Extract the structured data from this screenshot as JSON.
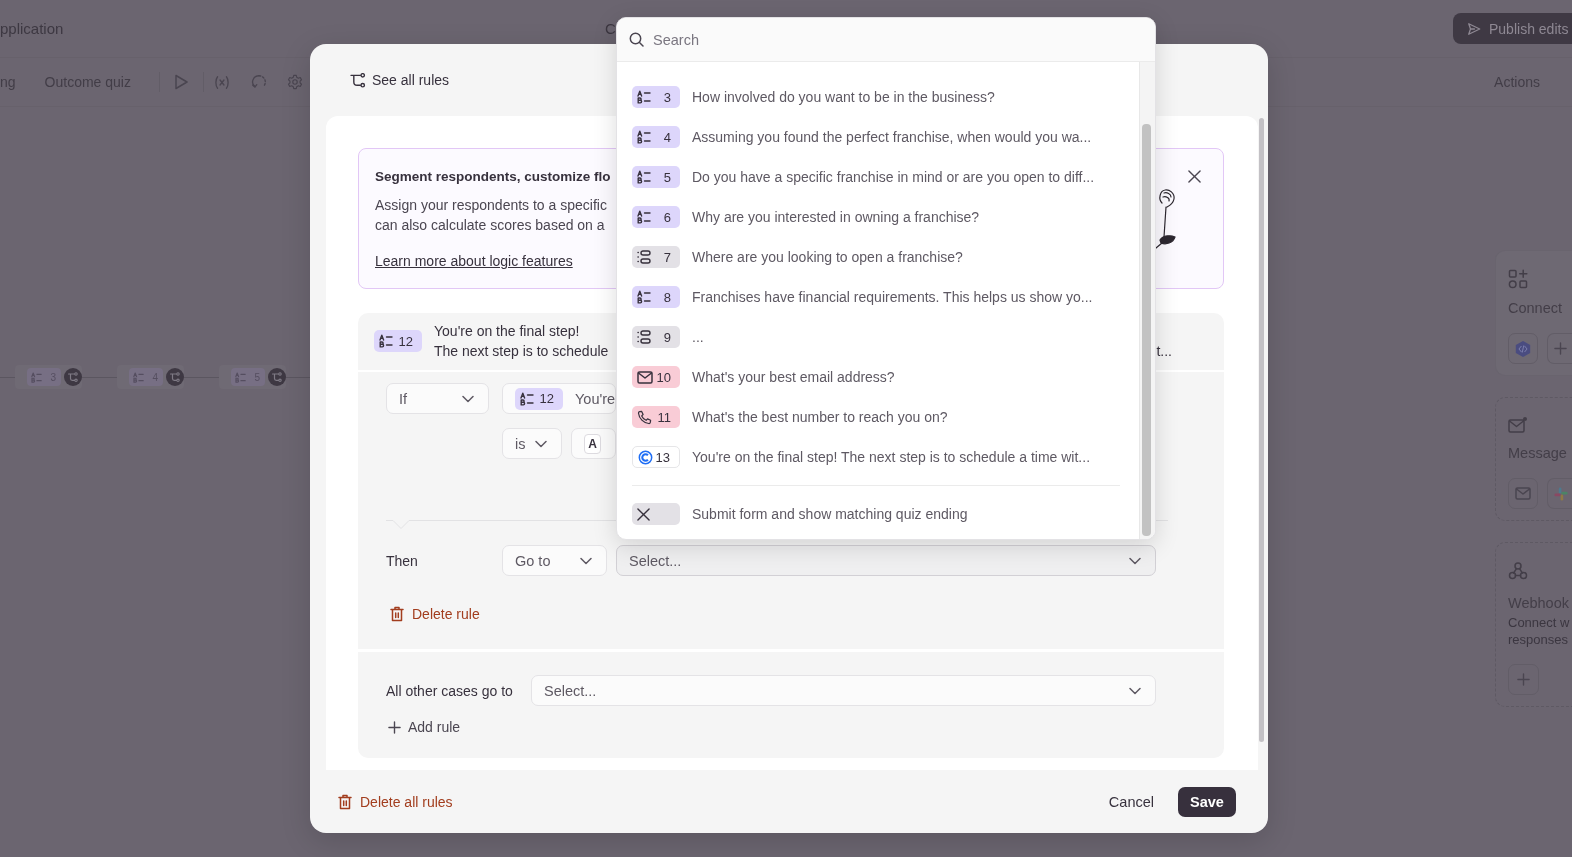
{
  "background": {
    "top_bar": {
      "title": "pplication",
      "center_text": "C",
      "publish_button": "Publish edits"
    },
    "toolbar": {
      "tabs": [
        "ng",
        "Outcome quiz"
      ],
      "actions_label": "Actions"
    },
    "canvas_nodes": [
      {
        "number": "3"
      },
      {
        "number": "4"
      },
      {
        "number": "5"
      }
    ],
    "integrations": [
      {
        "kind": "connect",
        "title": "Connect"
      },
      {
        "kind": "messages",
        "title": "Message"
      },
      {
        "kind": "webhook",
        "title": "Webhook",
        "description_lines": [
          "Connect w",
          "responses"
        ]
      }
    ]
  },
  "modal": {
    "header_link": "See all rules",
    "info_card": {
      "title": "Segment respondents, customize flo",
      "body_lines": [
        "Assign your respondents to a specific",
        "can also calculate scores based on a"
      ],
      "link": "Learn more about logic features"
    },
    "rule": {
      "question": {
        "kind": "multiple_choice",
        "number": "12",
        "lines": [
          "You're on the final step!",
          "The next step is to schedule"
        ],
        "tail": "t..."
      },
      "condition": {
        "operator_select": "If",
        "question": {
          "kind": "multiple_choice",
          "number": "12",
          "text": "You're"
        },
        "comparison_select": "is",
        "answer_key": "A"
      },
      "then_label": "Then",
      "action_select": "Go to",
      "target_select": {
        "text": "Select...",
        "open": true
      },
      "delete_rule": "Delete rule"
    },
    "fallback": {
      "label": "All other cases go to",
      "select_text": "Select...",
      "add_rule": "Add rule"
    },
    "footer": {
      "delete_all": "Delete all rules",
      "cancel": "Cancel",
      "save": "Save"
    }
  },
  "dropdown": {
    "search": {
      "placeholder": "Search"
    },
    "items": [
      {
        "kind": "multiple_choice",
        "number": "3",
        "text": "How involved do you want to be in the business?"
      },
      {
        "kind": "multiple_choice",
        "number": "4",
        "text": "Assuming you found the perfect franchise, when would you wa..."
      },
      {
        "kind": "multiple_choice",
        "number": "5",
        "text": "Do you have a specific franchise in mind or are you open to diff..."
      },
      {
        "kind": "multiple_choice",
        "number": "6",
        "text": "Why are you interested in owning a franchise?"
      },
      {
        "kind": "dropdown",
        "number": "7",
        "text": "Where are you looking to open a franchise?"
      },
      {
        "kind": "multiple_choice",
        "number": "8",
        "text": "Franchises have financial requirements. This helps us show yo..."
      },
      {
        "kind": "dropdown",
        "number": "9",
        "text": "..."
      },
      {
        "kind": "email",
        "number": "10",
        "text": "What's your best email address?"
      },
      {
        "kind": "phone",
        "number": "11",
        "text": "What's the best number to reach you on?"
      },
      {
        "kind": "calendly",
        "number": "13",
        "text": "You're on the final step! The next step is to schedule a time wit..."
      }
    ],
    "ending": {
      "kind": "ending",
      "text": "Submit form and show matching quiz ending"
    }
  }
}
